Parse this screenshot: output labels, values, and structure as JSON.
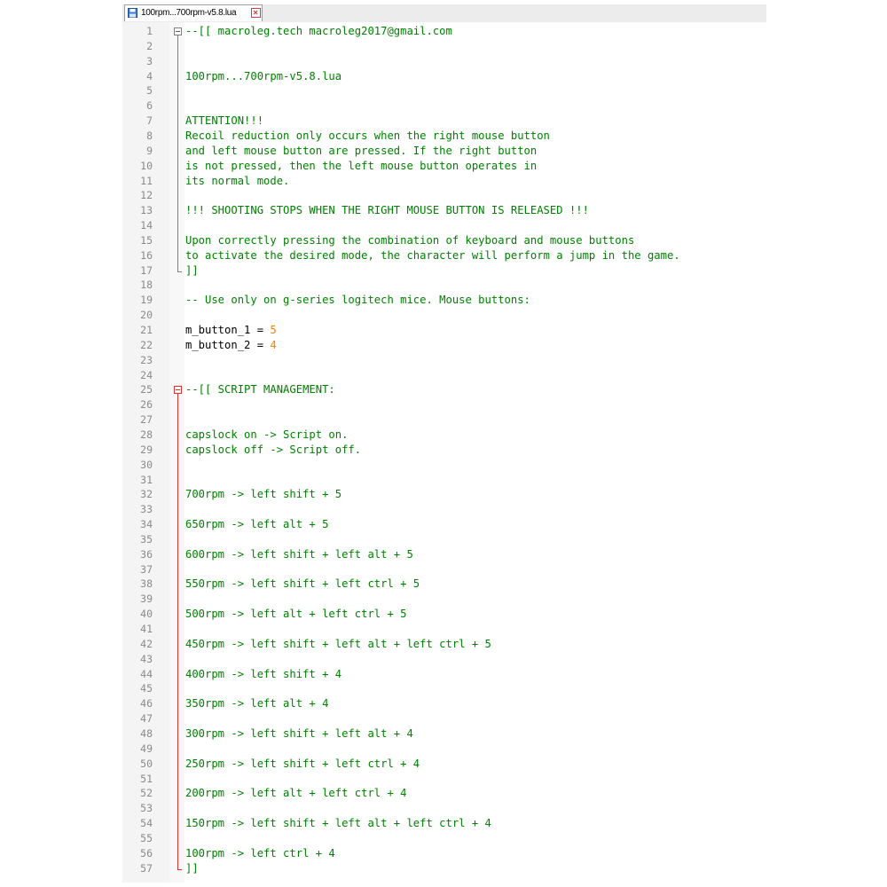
{
  "tab": {
    "label": "100rpm...700rpm-v5.8.lua",
    "save_icon": "save-icon",
    "close_icon": "close-icon"
  },
  "lines": [
    {
      "n": "1",
      "parts": [
        {
          "t": "--[[ macroleg.tech macroleg2017@gmail.com",
          "c": "cm"
        }
      ]
    },
    {
      "n": "2",
      "parts": []
    },
    {
      "n": "3",
      "parts": []
    },
    {
      "n": "4",
      "parts": [
        {
          "t": "100rpm...700rpm-v5.8.lua",
          "c": "cm"
        }
      ]
    },
    {
      "n": "5",
      "parts": []
    },
    {
      "n": "6",
      "parts": []
    },
    {
      "n": "7",
      "parts": [
        {
          "t": "ATTENTION!!!",
          "c": "cm"
        }
      ]
    },
    {
      "n": "8",
      "parts": [
        {
          "t": "Recoil reduction only occurs when the right mouse button",
          "c": "cm"
        }
      ]
    },
    {
      "n": "9",
      "parts": [
        {
          "t": "and left mouse button are pressed. If the right button",
          "c": "cm"
        }
      ]
    },
    {
      "n": "10",
      "parts": [
        {
          "t": "is not pressed, then the left mouse button operates in",
          "c": "cm"
        }
      ]
    },
    {
      "n": "11",
      "parts": [
        {
          "t": "its normal mode.",
          "c": "cm"
        }
      ]
    },
    {
      "n": "12",
      "parts": []
    },
    {
      "n": "13",
      "parts": [
        {
          "t": "!!! SHOOTING STOPS WHEN THE RIGHT MOUSE BUTTON IS RELEASED !!!",
          "c": "cm"
        }
      ]
    },
    {
      "n": "14",
      "parts": []
    },
    {
      "n": "15",
      "parts": [
        {
          "t": "Upon correctly pressing the combination of keyboard and mouse buttons",
          "c": "cm"
        }
      ]
    },
    {
      "n": "16",
      "parts": [
        {
          "t": "to activate the desired mode, the character will perform a jump in the game.",
          "c": "cm"
        }
      ]
    },
    {
      "n": "17",
      "parts": [
        {
          "t": "]]",
          "c": "cm"
        }
      ]
    },
    {
      "n": "18",
      "parts": []
    },
    {
      "n": "19",
      "parts": [
        {
          "t": "-- Use only on g-series logitech mice. Mouse buttons:",
          "c": "cm"
        }
      ]
    },
    {
      "n": "20",
      "parts": []
    },
    {
      "n": "21",
      "parts": [
        {
          "t": "m_button_1 = ",
          "c": "pl"
        },
        {
          "t": "5",
          "c": "num"
        }
      ]
    },
    {
      "n": "22",
      "parts": [
        {
          "t": "m_button_2 = ",
          "c": "pl"
        },
        {
          "t": "4",
          "c": "num"
        }
      ]
    },
    {
      "n": "23",
      "parts": []
    },
    {
      "n": "24",
      "parts": []
    },
    {
      "n": "25",
      "parts": [
        {
          "t": "--[[ SCRIPT MANAGEMENT:",
          "c": "cm"
        }
      ]
    },
    {
      "n": "26",
      "parts": []
    },
    {
      "n": "27",
      "parts": []
    },
    {
      "n": "28",
      "parts": [
        {
          "t": "capslock on -> Script on.",
          "c": "cm"
        }
      ]
    },
    {
      "n": "29",
      "parts": [
        {
          "t": "capslock off -> Script off.",
          "c": "cm"
        }
      ]
    },
    {
      "n": "30",
      "parts": []
    },
    {
      "n": "31",
      "parts": []
    },
    {
      "n": "32",
      "parts": [
        {
          "t": "700rpm -> left shift + 5",
          "c": "cm"
        }
      ]
    },
    {
      "n": "33",
      "parts": []
    },
    {
      "n": "34",
      "parts": [
        {
          "t": "650rpm -> left alt + 5",
          "c": "cm"
        }
      ]
    },
    {
      "n": "35",
      "parts": []
    },
    {
      "n": "36",
      "parts": [
        {
          "t": "600rpm -> left shift + left alt + 5",
          "c": "cm"
        }
      ]
    },
    {
      "n": "37",
      "parts": []
    },
    {
      "n": "38",
      "parts": [
        {
          "t": "550rpm -> left shift + left ctrl + 5",
          "c": "cm"
        }
      ]
    },
    {
      "n": "39",
      "parts": []
    },
    {
      "n": "40",
      "parts": [
        {
          "t": "500rpm -> left alt + left ctrl + 5",
          "c": "cm"
        }
      ]
    },
    {
      "n": "41",
      "parts": []
    },
    {
      "n": "42",
      "parts": [
        {
          "t": "450rpm -> left shift + left alt + left ctrl + 5",
          "c": "cm"
        }
      ]
    },
    {
      "n": "43",
      "parts": []
    },
    {
      "n": "44",
      "parts": [
        {
          "t": "400rpm -> left shift + 4",
          "c": "cm"
        }
      ]
    },
    {
      "n": "45",
      "parts": []
    },
    {
      "n": "46",
      "parts": [
        {
          "t": "350rpm -> left alt + 4",
          "c": "cm"
        }
      ]
    },
    {
      "n": "47",
      "parts": []
    },
    {
      "n": "48",
      "parts": [
        {
          "t": "300rpm -> left shift + left alt + 4",
          "c": "cm"
        }
      ]
    },
    {
      "n": "49",
      "parts": []
    },
    {
      "n": "50",
      "parts": [
        {
          "t": "250rpm -> left shift + left ctrl + 4",
          "c": "cm"
        }
      ]
    },
    {
      "n": "51",
      "parts": []
    },
    {
      "n": "52",
      "parts": [
        {
          "t": "200rpm -> left alt + left ctrl + 4",
          "c": "cm"
        }
      ]
    },
    {
      "n": "53",
      "parts": []
    },
    {
      "n": "54",
      "parts": [
        {
          "t": "150rpm -> left shift + left alt + left ctrl + 4",
          "c": "cm"
        }
      ]
    },
    {
      "n": "55",
      "parts": []
    },
    {
      "n": "56",
      "parts": [
        {
          "t": "100rpm -> left ctrl + 4",
          "c": "cm"
        }
      ]
    },
    {
      "n": "57",
      "parts": [
        {
          "t": "]]",
          "c": "cm"
        }
      ]
    }
  ],
  "colors": {
    "comment": "#008000",
    "number": "#ff8000",
    "plain": "#000000",
    "line_number": "#8a8a8a",
    "fold_active": "#e03030",
    "fold_inactive": "#808080"
  },
  "fold_markers": [
    {
      "start": 1,
      "end": 17,
      "active": false
    },
    {
      "start": 25,
      "end": 57,
      "active": true
    }
  ]
}
